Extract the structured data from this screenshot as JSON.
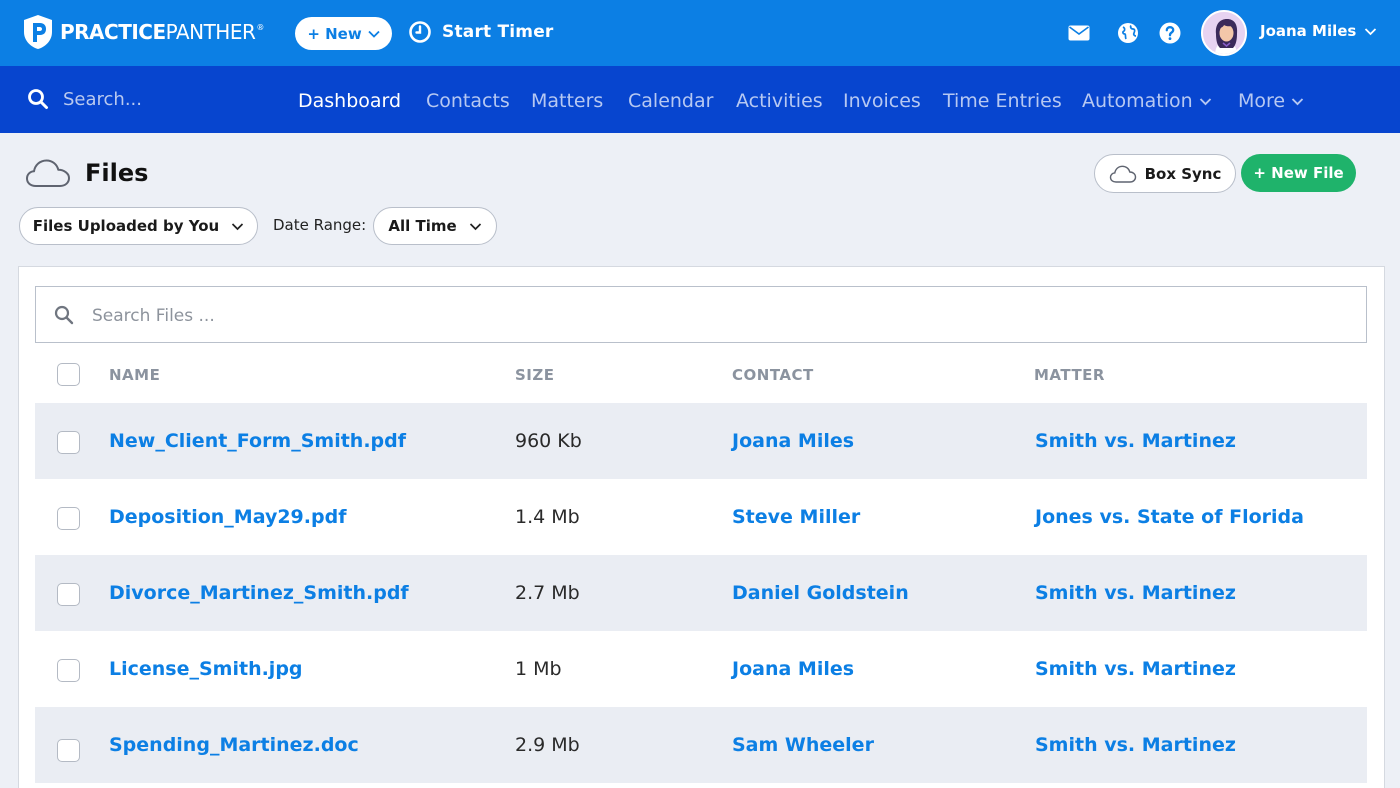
{
  "topbar": {
    "brand_bold": "PRACTICE",
    "brand_thin": "PANTHER",
    "brand_reg": "®",
    "new_label": "+ New",
    "timer_label": "Start Timer",
    "user_name": "Joana Miles"
  },
  "nav": {
    "search_placeholder": "Search...",
    "items": [
      {
        "label": "Dashboard",
        "active": true
      },
      {
        "label": "Contacts"
      },
      {
        "label": "Matters"
      },
      {
        "label": "Calendar"
      },
      {
        "label": "Activities"
      },
      {
        "label": "Invoices"
      },
      {
        "label": "Time Entries"
      },
      {
        "label": "Automation"
      },
      {
        "label": "More"
      }
    ]
  },
  "page": {
    "title": "Files",
    "box_sync_label": "Box Sync",
    "new_file_label": "+ New File",
    "filter_label": "Files Uploaded by You",
    "date_range_label": "Date Range:",
    "date_range_value": "All Time"
  },
  "table": {
    "search_placeholder": "Search Files ...",
    "headers": [
      "NAME",
      "SIZE",
      "CONTACT",
      "MATTER"
    ],
    "rows": [
      {
        "name": "New_Client_Form_Smith.pdf",
        "size": "960 Kb",
        "contact": "Joana Miles",
        "matter": "Smith vs. Martinez"
      },
      {
        "name": "Deposition_May29.pdf",
        "size": "1.4 Mb",
        "contact": "Steve Miller",
        "matter": "Jones vs. State of Florida"
      },
      {
        "name": "Divorce_Martinez_Smith.pdf",
        "size": "2.7 Mb",
        "contact": "Daniel Goldstein",
        "matter": "Smith vs. Martinez"
      },
      {
        "name": "License_Smith.jpg",
        "size": "1 Mb",
        "contact": "Joana Miles",
        "matter": "Smith vs. Martinez"
      },
      {
        "name": "Spending_Martinez.doc",
        "size": "2.9 Mb",
        "contact": "Sam Wheeler",
        "matter": "Smith vs. Martinez"
      }
    ]
  },
  "icons": {
    "logo": "panther-logo-icon",
    "timer": "clock-icon",
    "mail": "mail-icon",
    "globe": "globe-icon",
    "help": "help-icon",
    "search": "search-icon",
    "cloud": "cloud-icon"
  },
  "colors": {
    "topbar": "#0c7fe4",
    "navbar": "#0745cf",
    "link": "#0c7fe4",
    "new_file": "#1fb36b",
    "row_alt": "#eaedf3"
  }
}
